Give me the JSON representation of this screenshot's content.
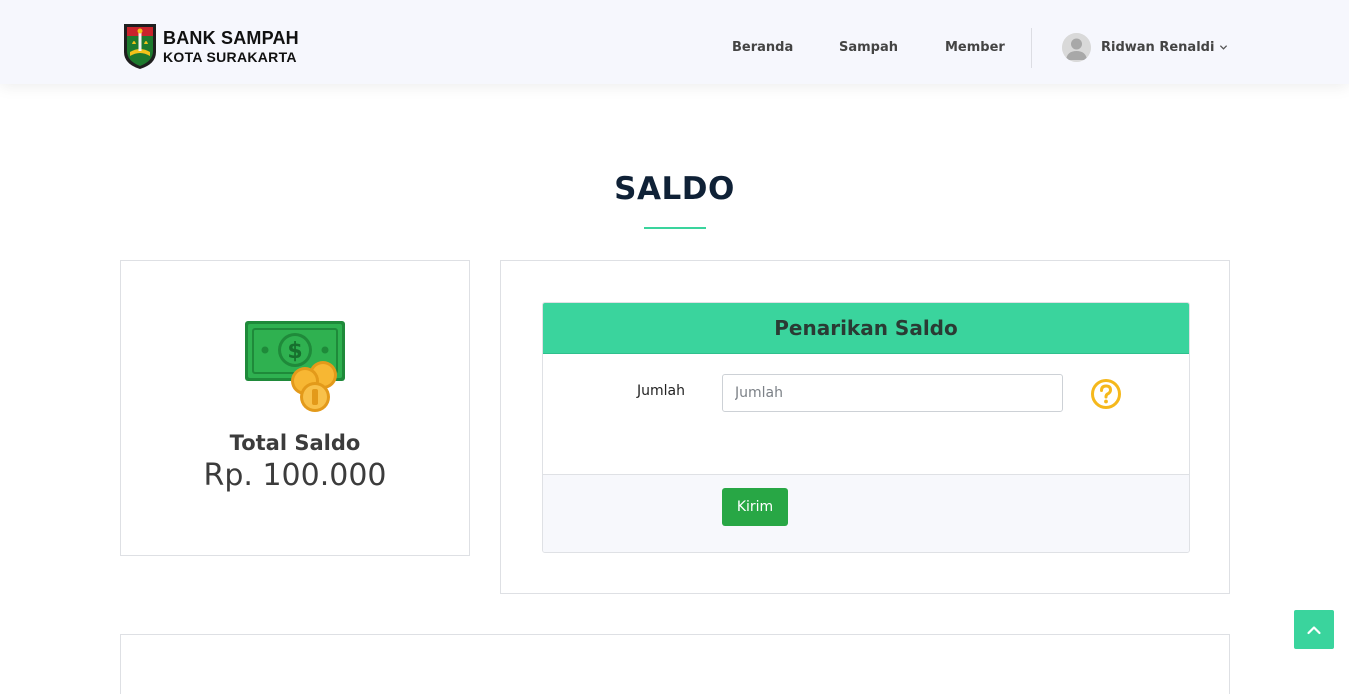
{
  "brand": {
    "line1": "BANK SAMPAH",
    "line2": "KOTA SURAKARTA",
    "emblem_icon": "city-emblem-icon"
  },
  "nav": {
    "items": [
      {
        "label": "Beranda"
      },
      {
        "label": "Sampah"
      },
      {
        "label": "Member"
      }
    ],
    "user": {
      "name": "Ridwan Renaldi",
      "avatar_icon": "user-avatar-icon",
      "dropdown_icon": "chevron-down-icon"
    }
  },
  "page": {
    "title": "SALDO"
  },
  "balance": {
    "icon": "money-coins-icon",
    "label": "Total Saldo",
    "value": "Rp. 100.000"
  },
  "withdraw": {
    "heading": "Penarikan Saldo",
    "amount_label": "Jumlah",
    "amount_placeholder": "Jumlah",
    "amount_value": "",
    "help_icon": "question-circle-icon",
    "submit_label": "Kirim"
  },
  "back_to_top": {
    "icon": "chevron-up-icon"
  },
  "colors": {
    "accent": "#3ad49d",
    "button": "#28a745",
    "title": "#0f2136",
    "help": "#f5b81c",
    "header_bg": "#f6f7fd"
  }
}
